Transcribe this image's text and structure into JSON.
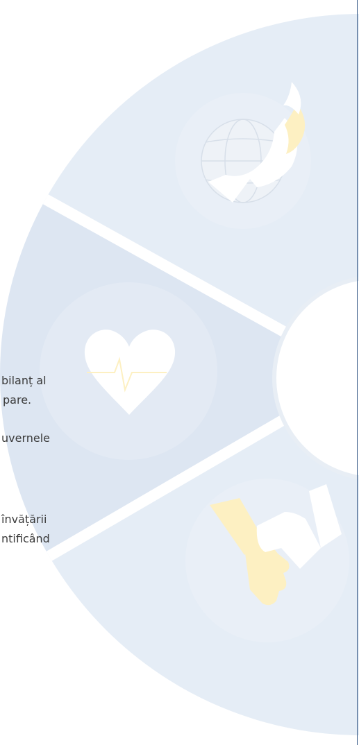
{
  "text_lines": [
    "bilanț al",
    "pare.",
    "uvernele",
    "învățării",
    "ntificând"
  ],
  "colors": {
    "segment_light": "#e5edf6",
    "segment_mid": "#dde6f2",
    "center": "#ffffff",
    "accent_yellow": "#fdf0c2",
    "icon_white": "#ffffff",
    "edge_line": "#3d5f8a"
  },
  "icons": [
    "globe-flame-icon",
    "heart-pulse-icon",
    "handshake-icon"
  ]
}
